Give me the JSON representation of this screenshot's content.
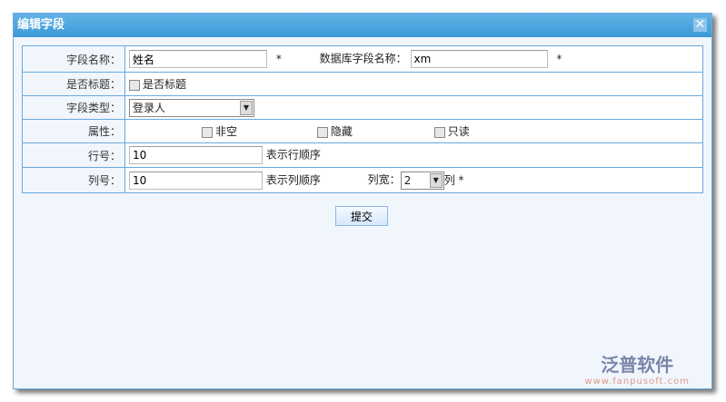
{
  "title": "编辑字段",
  "fields": {
    "name_label": "字段名称：",
    "name_value": "姓名",
    "required": "*",
    "db_label": "数据库字段名称：",
    "db_value": "xm",
    "is_title_label": "是否标题：",
    "is_title_check": "是否标题",
    "type_label": "字段类型：",
    "type_value": "登录人",
    "attr_label": "属性：",
    "attr_options": [
      "非空",
      "隐藏",
      "只读"
    ],
    "row_label": "行号：",
    "row_value": "10",
    "row_hint": "表示行顺序",
    "col_label": "列号：",
    "col_value": "10",
    "col_hint": "表示列顺序",
    "width_label": "列宽：",
    "width_value": "2",
    "width_unit": "列"
  },
  "submit": "提交",
  "logo": {
    "name": "泛普软件",
    "url": "www.fanpusoft.com"
  }
}
